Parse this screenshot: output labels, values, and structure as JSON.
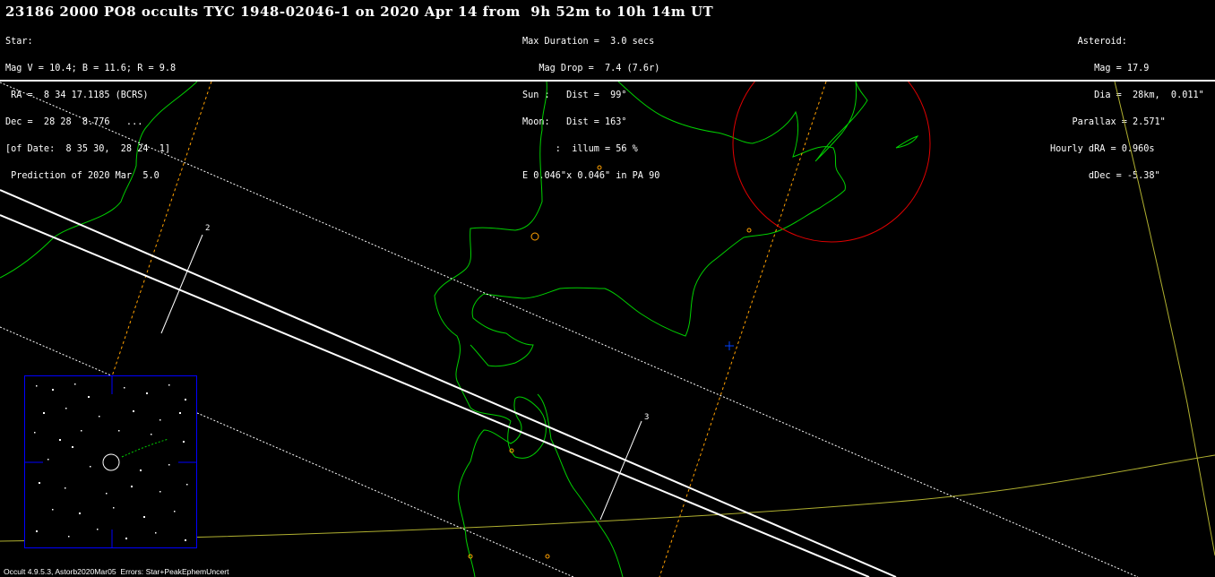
{
  "title": "23186 2000 PO8 occults TYC 1948-02046-1 on 2020 Apr 14 from  9h 52m to 10h 14m UT",
  "star": {
    "lines": [
      "Star:",
      "Mag V = 10.4; B = 11.6; R = 9.8",
      " RA =  8 34 17.1185 (BCRS)",
      "Dec =  28 28  8.776   ...",
      "[of Date:  8 35 30,  28 24  1]",
      " Prediction of 2020 Mar  5.0"
    ]
  },
  "event": {
    "lines": [
      "Max Duration =  3.0 secs",
      "   Mag Drop =  7.4 (7.6r)",
      "Sun :   Dist =  99°",
      "Moon:   Dist = 163°",
      "      :  illum = 56 %",
      "E 0.046\"x 0.046\" in PA 90"
    ]
  },
  "asteroid": {
    "lines": [
      "     Asteroid:",
      "        Mag = 17.9",
      "        Dia =  28km,  0.011\"",
      "    Parallax = 2.571\"",
      "Hourly dRA = 0.960s",
      "       dDec = -5.38\""
    ]
  },
  "map": {
    "time_labels": [
      "2",
      "3"
    ],
    "colors": {
      "coastline": "#00d000",
      "path": "#ffffff",
      "uncertainty": "#ffffff",
      "sigma": "#ffa000",
      "observer_circle": "#e00000",
      "site_marker": "#0040ff",
      "grid": "#b0b030",
      "inset_border": "#0000ff"
    }
  },
  "footer": "Occult 4.9.5.3, Astorb2020Mar05  Errors: Star+PeakEphemUncert"
}
